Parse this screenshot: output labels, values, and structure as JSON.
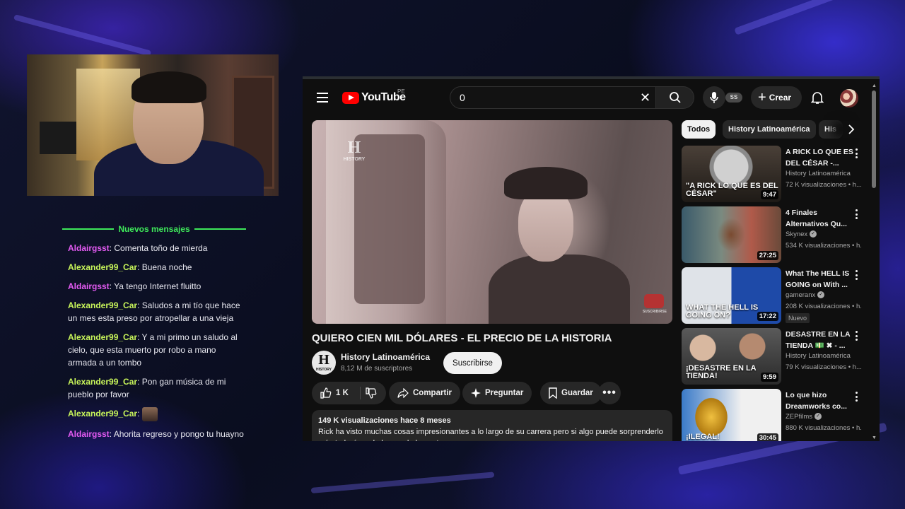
{
  "chat": {
    "divider_label": "Nuevos mensajes",
    "messages": [
      {
        "user": "Aldairgsst",
        "text": " Comenta toño de mierda",
        "color": "#e45bf3"
      },
      {
        "user": "Alexander99_Car",
        "text": " Buena noche",
        "color": "#c8f55a"
      },
      {
        "user": "Aldairgsst",
        "text": " Ya tengo Internet fluitto",
        "color": "#e45bf3"
      },
      {
        "user": "Alexander99_Car",
        "text": " Saludos a mi tío que hace un mes esta preso por atropellar a una vieja",
        "color": "#c8f55a"
      },
      {
        "user": "Alexander99_Car",
        "text": " Y a mi primo un saludo al cielo, que esta muerto por robo a mano armada a un tombo",
        "color": "#c8f55a"
      },
      {
        "user": "Alexander99_Car",
        "text": " Pon gan música de mi pueblo por favor",
        "color": "#c8f55a"
      },
      {
        "user": "Alexander99_Car",
        "text": "",
        "color": "#c8f55a",
        "emote": "emote-face-icon"
      },
      {
        "user": "Aldairgsst",
        "text": " Ahorita regreso y pongo tu huayno",
        "color": "#e45bf3"
      }
    ]
  },
  "youtube": {
    "logo_text": "YouTube",
    "country_code": "PE",
    "search_value": "0",
    "ss_badge": "SS",
    "create_label": "Crear",
    "player": {
      "watermark": "HISTORY",
      "subscribe_watermark": "SUSCRIBIRSE"
    },
    "video_title": "QUIERO CIEN MIL DÓLARES - EL PRECIO DE LA HISTORIA",
    "channel": {
      "name": "History Latinoamérica",
      "subscribers": "8,12 M de suscriptores",
      "avatar_letter": "H",
      "avatar_caption": "HISTORY"
    },
    "subscribe_label": "Suscribirse",
    "actions": {
      "likes": "1 K",
      "share": "Compartir",
      "ask": "Preguntar",
      "save": "Guardar"
    },
    "description": {
      "meta": "149 K visualizaciones  hace 8 meses",
      "text": "Rick ha visto muchas cosas impresionantes a lo largo de su carrera pero si algo puede sorprenderlo más todavía es la locura de la gente"
    },
    "chips": [
      "Todos",
      "History Latinoamérica",
      "His"
    ],
    "recommendations": [
      {
        "title": "A RICK LO QUE ES DEL CÉSAR -...",
        "channel": "History Latinoamérica",
        "verified": false,
        "views": "72 K visualizaciones • h...",
        "duration": "9:47",
        "thumb_caption": "\"A RICK LO QUE ES DEL CÉSAR\"",
        "badge": ""
      },
      {
        "title": "4 Finales Alternativos Qu...",
        "channel": "Skynex",
        "verified": true,
        "views": "534 K visualizaciones • h...",
        "duration": "27:25",
        "thumb_caption": "",
        "badge": ""
      },
      {
        "title": "What The HELL IS GOING on With ...",
        "channel": "gameranx",
        "verified": true,
        "views": "208 K visualizaciones • h...",
        "duration": "17:22",
        "thumb_caption": "WHAT THE HELL IS GOING ON?",
        "badge": "Nuevo"
      },
      {
        "title": "DESASTRE EN LA TIENDA 💵 ✖ - ...",
        "channel": "History Latinoamérica",
        "verified": false,
        "views": "79 K visualizaciones • h...",
        "duration": "9:59",
        "thumb_caption": "¡DESASTRE EN LA TIENDA!",
        "badge": ""
      },
      {
        "title": "Lo que hizo Dreamworks co...",
        "channel": "ZEPfilms",
        "verified": true,
        "views": "880 K visualizaciones • h...",
        "duration": "30:45",
        "thumb_caption": "¡ILEGAL!",
        "badge": ""
      }
    ]
  }
}
